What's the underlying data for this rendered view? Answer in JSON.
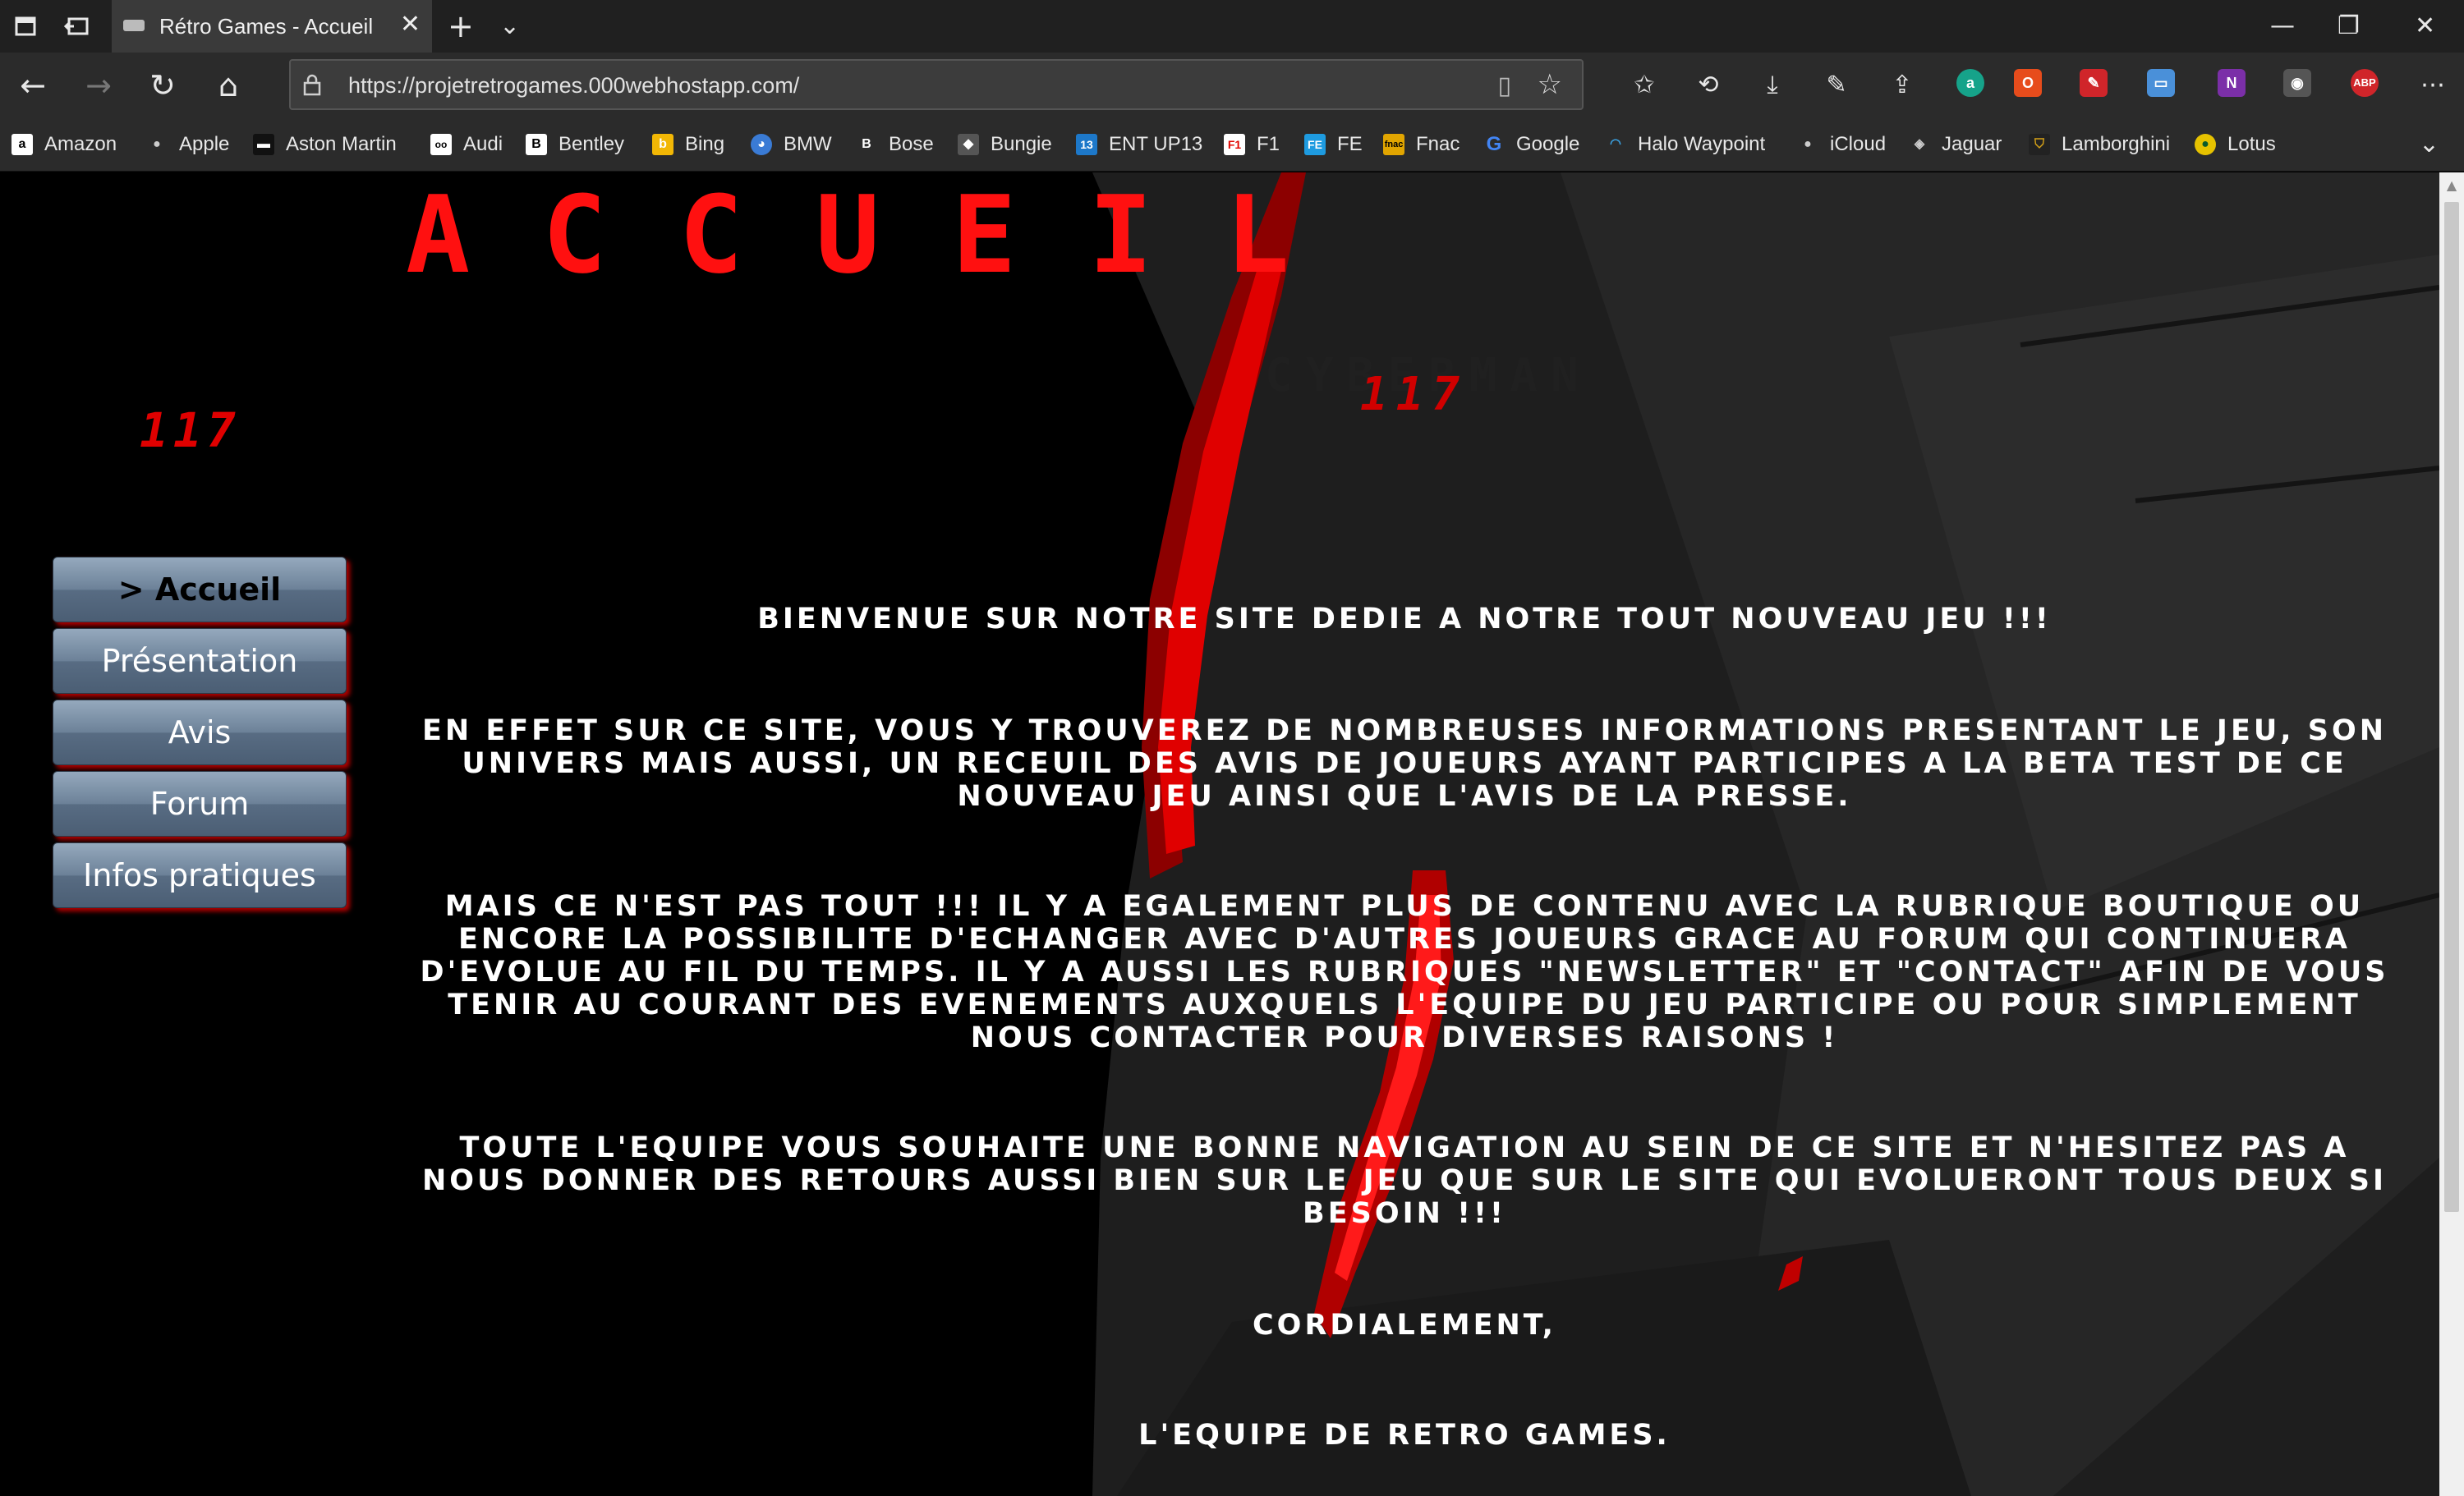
{
  "browser": {
    "tab_title": "Rétro Games - Accueil",
    "url": "https://projetretrogames.000webhostapp.com/",
    "extensions": [
      "a",
      "O",
      "ABP"
    ],
    "favorites": [
      {
        "label": "Amazon",
        "icon": "amazon-icon"
      },
      {
        "label": "Apple",
        "icon": "apple-icon"
      },
      {
        "label": "Aston Martin",
        "icon": "aston-martin-icon"
      },
      {
        "label": "Audi",
        "icon": "audi-icon"
      },
      {
        "label": "Bentley",
        "icon": "bentley-icon"
      },
      {
        "label": "Bing",
        "icon": "bing-icon"
      },
      {
        "label": "BMW",
        "icon": "bmw-icon"
      },
      {
        "label": "Bose",
        "icon": "bose-icon"
      },
      {
        "label": "Bungie",
        "icon": "bungie-icon"
      },
      {
        "label": "ENT UP13",
        "icon": "ent-icon"
      },
      {
        "label": "F1",
        "icon": "f1-icon"
      },
      {
        "label": "FE",
        "icon": "fe-icon"
      },
      {
        "label": "Fnac",
        "icon": "fnac-icon"
      },
      {
        "label": "Google",
        "icon": "google-icon"
      },
      {
        "label": "Halo Waypoint",
        "icon": "halo-icon"
      },
      {
        "label": "iCloud",
        "icon": "icloud-icon"
      },
      {
        "label": "Jaguar",
        "icon": "jaguar-icon"
      },
      {
        "label": "Lamborghini",
        "icon": "lamborghini-icon"
      },
      {
        "label": "Lotus",
        "icon": "lotus-icon"
      }
    ]
  },
  "site": {
    "title": "ACCUEIL",
    "logo_number": "117",
    "logo_name": "CYBERMAN",
    "menu": [
      {
        "label": "> Accueil",
        "active": true
      },
      {
        "label": "Présentation",
        "active": false
      },
      {
        "label": "Avis",
        "active": false
      },
      {
        "label": "Forum",
        "active": false
      },
      {
        "label": "Infos pratiques",
        "active": false
      }
    ],
    "paragraphs": [
      "BIENVENUE SUR NOTRE SITE DEDIE A NOTRE TOUT NOUVEAU JEU !!!",
      "EN EFFET SUR CE SITE, VOUS Y TROUVEREZ DE NOMBREUSES INFORMATIONS PRESENTANT LE JEU, SON UNIVERS MAIS AUSSI, UN RECEUIL DES AVIS DE JOUEURS AYANT PARTICIPES A LA BETA TEST DE CE NOUVEAU JEU AINSI QUE L'AVIS DE LA PRESSE.",
      "MAIS CE N'EST PAS TOUT !!! IL Y A EGALEMENT PLUS DE CONTENU AVEC LA RUBRIQUE BOUTIQUE OU ENCORE LA POSSIBILITE D'ECHANGER AVEC D'AUTRES JOUEURS GRACE AU FORUM QUI CONTINUERA D'EVOLUE AU FIL DU TEMPS. IL Y A AUSSI LES RUBRIQUES \"NEWSLETTER\" ET \"CONTACT\" AFIN DE VOUS TENIR AU COURANT DES EVENEMENTS AUXQUELS L'EQUIPE DU JEU PARTICIPE OU POUR SIMPLEMENT NOUS CONTACTER POUR DIVERSES RAISONS !",
      "TOUTE L'EQUIPE VOUS SOUHAITE UNE BONNE NAVIGATION AU SEIN DE CE SITE ET N'HESITEZ PAS A NOUS DONNER DES RETOURS AUSSI BIEN SUR LE JEU QUE SUR LE SITE QUI EVOLUERONT TOUS DEUX SI BESOIN !!!",
      "CORDIALEMENT,",
      "L'EQUIPE DE RETRO GAMES."
    ]
  },
  "colors": {
    "accent_red": "#ff1010",
    "button_blue": "#6c8198"
  }
}
